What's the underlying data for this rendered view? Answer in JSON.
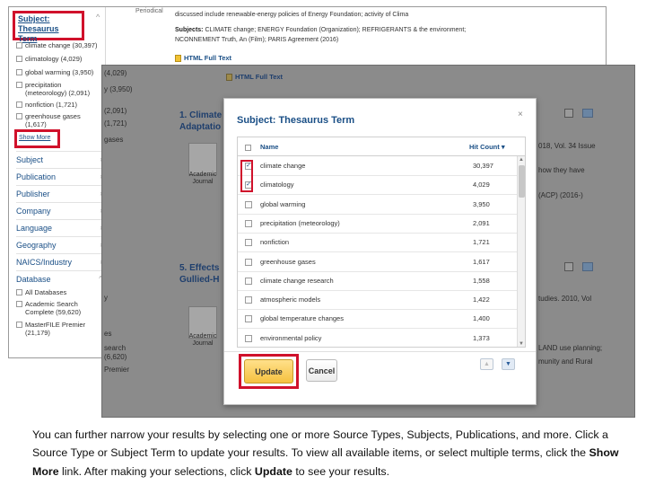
{
  "back": {
    "filter_heading": "Subject: Thesaurus Term",
    "periodical_label": "Periodical",
    "filter_options": [
      {
        "label": "climate change (30,397)"
      },
      {
        "label": "climatology (4,029)"
      },
      {
        "label": "global warming (3,950)"
      },
      {
        "label": "precipitation (meteorology) (2,091)"
      },
      {
        "label": "nonfiction (1,721)"
      },
      {
        "label": "greenhouse gases (1,617)"
      }
    ],
    "show_more": "Show More",
    "categories": [
      "Subject",
      "Publication",
      "Publisher",
      "Company",
      "Language",
      "Geography",
      "NAICS/Industry",
      "Database"
    ],
    "databases": [
      {
        "label": "All Databases"
      },
      {
        "label": "Academic Search Complete (59,620)"
      },
      {
        "label": "MasterFILE Premier (21,179)"
      }
    ],
    "result_line1": "discussed include renewable-energy policies of Energy Foundation; activity of Clima",
    "result_line2_label": "Subjects:",
    "result_line2_rest": "CLIMATE change; ENERGY Foundation (Organization); REFRIGERANTS & the environment;",
    "result_line3": "NCONNEMENT Truth, An (Film); PARIS Agreement (2016)",
    "html_full_text": "HTML Full Text"
  },
  "overlay": {
    "html_full_text": "HTML Full Text",
    "left_counts": [
      "(4,029)",
      "y (3,950)",
      "(2,091)",
      "(1,721)",
      "gases"
    ],
    "left_bottom": [
      "y",
      "es",
      "search",
      "(6,620)",
      "Premier"
    ],
    "result1_number_title": "1. Climate",
    "result1_sub": "Adaptatio",
    "result5_number_title": "5. Effects",
    "result5_sub": "Gullied-H",
    "academic_journal": "Academic Journal",
    "right_text_1": [
      "018, Vol. 34 Issue",
      "how they have"
    ],
    "right_text_2": [
      "(ACP) (2016-)"
    ],
    "right_text_3": [
      "tudies. 2010, Vol",
      "LAND use planning;",
      "munity and Rural"
    ]
  },
  "modal": {
    "title": "Subject: Thesaurus Term",
    "close": "×",
    "col_name": "Name",
    "col_count": "Hit Count",
    "sort_indicator": "▾",
    "rows": [
      {
        "name": "climate change",
        "count": "30,397",
        "checked": true
      },
      {
        "name": "climatology",
        "count": "4,029",
        "checked": true
      },
      {
        "name": "global warming",
        "count": "3,950",
        "checked": false
      },
      {
        "name": "precipitation (meteorology)",
        "count": "2,091",
        "checked": false
      },
      {
        "name": "nonfiction",
        "count": "1,721",
        "checked": false
      },
      {
        "name": "greenhouse gases",
        "count": "1,617",
        "checked": false
      },
      {
        "name": "climate change research",
        "count": "1,558",
        "checked": false
      },
      {
        "name": "atmospheric models",
        "count": "1,422",
        "checked": false
      },
      {
        "name": "global temperature changes",
        "count": "1,400",
        "checked": false
      },
      {
        "name": "environmental policy",
        "count": "1,373",
        "checked": false
      }
    ],
    "update": "Update",
    "cancel": "Cancel",
    "page_up": "▲",
    "page_down": "▼"
  },
  "caption": {
    "part1": "You can further narrow your results by selecting one or more Source Types, Subjects, Publications, and more. Click a Source Type or Subject Term to update your results. To view all available items, or select multiple terms, click the ",
    "show_more": "Show More",
    "part2": " link.  After making your selections, click ",
    "update": "Update",
    "part3": " to see your results."
  },
  "colors": {
    "accent": "#1a4f86",
    "highlight": "#d0112b",
    "update_button": "#f5c13f",
    "overlay": "#8b8b8b"
  },
  "icons": [
    "checkbox-icon",
    "chevron-icon",
    "html-icon",
    "close-icon",
    "sort-desc-icon",
    "journal-icon",
    "folder-icon",
    "scroll-up-icon",
    "scroll-down-icon"
  ]
}
